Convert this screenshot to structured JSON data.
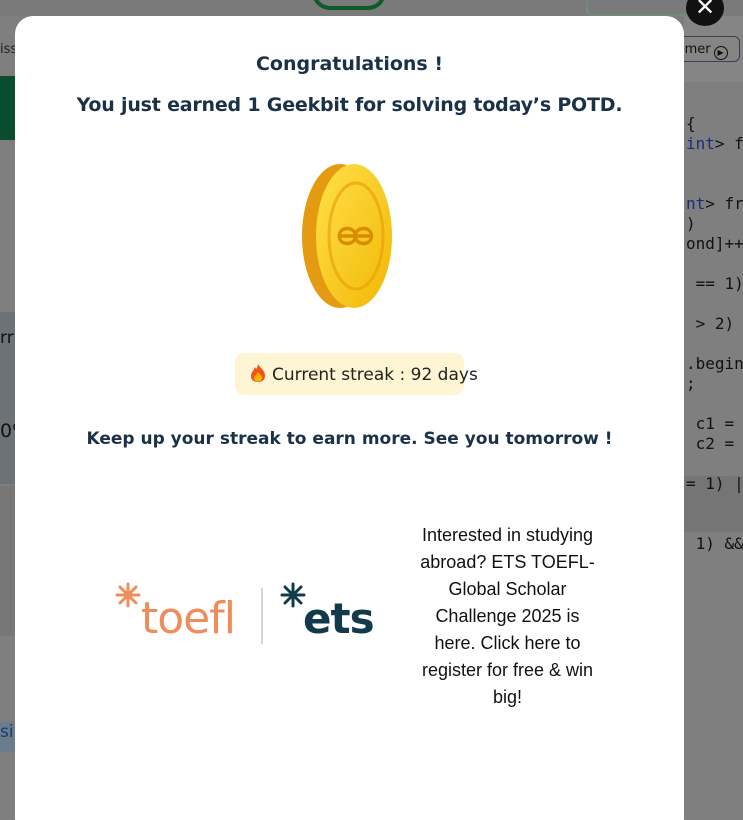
{
  "background": {
    "left_snippets": [
      "iss",
      "rr",
      "0%",
      "si"
    ],
    "toolbar_timer_label": "imer",
    "code_lines": [
      {
        "text": "{",
        "kw": ""
      },
      {
        "text": "",
        "kw": "int",
        "rest": "> f"
      },
      {
        "text": "",
        "kw": "",
        "rest": ""
      },
      {
        "text": "",
        "kw": "",
        "rest": ""
      },
      {
        "text": "",
        "kw": "nt",
        "rest": "> fr"
      },
      {
        "text": ")",
        "kw": ""
      },
      {
        "text": "ond]++",
        "kw": ""
      },
      {
        "text": "",
        "kw": ""
      },
      {
        "text": " == 1)",
        "kw": ""
      },
      {
        "text": "",
        "kw": ""
      },
      {
        "text": " > 2)",
        "kw": ""
      },
      {
        "text": "",
        "kw": ""
      },
      {
        "text": ".begin",
        "kw": ""
      },
      {
        "text": ";",
        "kw": ""
      },
      {
        "text": "",
        "kw": ""
      },
      {
        "text": " c1 =",
        "kw": ""
      },
      {
        "text": " c2 =",
        "kw": ""
      },
      {
        "text": "",
        "kw": ""
      },
      {
        "text": "= 1) |",
        "kw": ""
      },
      {
        "text": "",
        "kw": ""
      },
      {
        "text": "",
        "kw": ""
      },
      {
        "text": " 1) &&",
        "kw": ""
      }
    ]
  },
  "modal": {
    "title": "Congratulations !",
    "subtitle": "You just earned 1 Geekbit for solving today’s POTD.",
    "coin_icon": "geekbit-coin-icon",
    "streak": {
      "icon": "fire-icon",
      "label": "Current streak : 92 days"
    },
    "keep_up": "Keep up your streak to earn more. See you tomorrow !",
    "ad": {
      "logo_left": "toefl",
      "logo_right": "ets",
      "text": "Interested in studying abroad? ETS TOEFL- Global Scholar Challenge 2025 is here. Click here to register for free & win big!"
    },
    "close_icon": "close-icon",
    "close_glyph": "✕"
  },
  "colors": {
    "heading": "#1b3148",
    "streak_bg": "#fdf5d3",
    "coin_gold": "#f5c518",
    "toefl_orange": "#f08b5a",
    "ets_navy": "#123a4a"
  }
}
